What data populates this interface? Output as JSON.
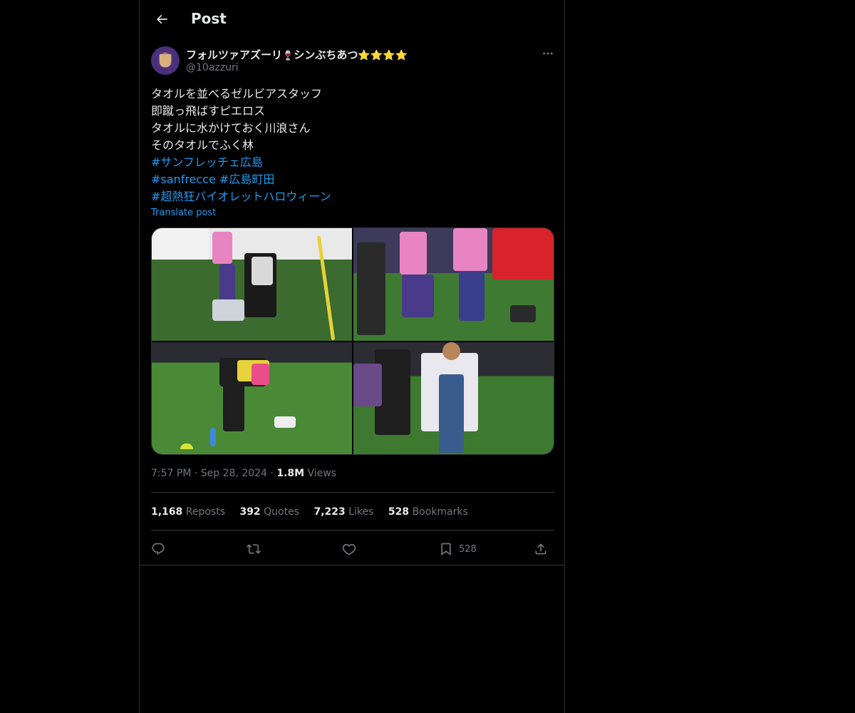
{
  "header": {
    "title": "Post"
  },
  "author": {
    "name": "フォルツァアズーリ",
    "name_emoji": "🍷",
    "name_suffix": "シンぶちあつ",
    "stars": "⭐⭐⭐⭐",
    "handle": "@10azzuri"
  },
  "tweet": {
    "lines": [
      "タオルを並べるゼルビアスタッフ",
      "即蹴っ飛ばすピエロス",
      "タオルに水かけておく川浪さん",
      "そのタオルでふく林"
    ],
    "hashtags": {
      "line1": "#サンフレッチェ広島",
      "line2a": "#sanfrecce",
      "line2b": "#広島町田",
      "line3": "#超熱狂バイオレットハロウィーン"
    },
    "translate": "Translate post"
  },
  "meta": {
    "time": "7:57 PM",
    "sep1": "·",
    "date": "Sep 28, 2024",
    "sep2": "·",
    "views": "1.8M",
    "views_label": "Views"
  },
  "stats": {
    "reposts": "1,168",
    "reposts_label": "Reposts",
    "quotes": "392",
    "quotes_label": "Quotes",
    "likes": "7,223",
    "likes_label": "Likes",
    "bookmarks": "528",
    "bookmarks_label": "Bookmarks"
  },
  "actions": {
    "bookmark_count": "528"
  },
  "icons": {
    "back": "arrow-left-icon",
    "more": "more-horizontal-icon",
    "reply": "reply-icon",
    "repost": "repost-icon",
    "like": "heart-icon",
    "bookmark": "bookmark-icon",
    "share": "share-icon"
  },
  "colors": {
    "background": "#000000",
    "text": "#e7e9ea",
    "muted": "#71767b",
    "link": "#1d9bf0",
    "border": "#2f3336"
  }
}
